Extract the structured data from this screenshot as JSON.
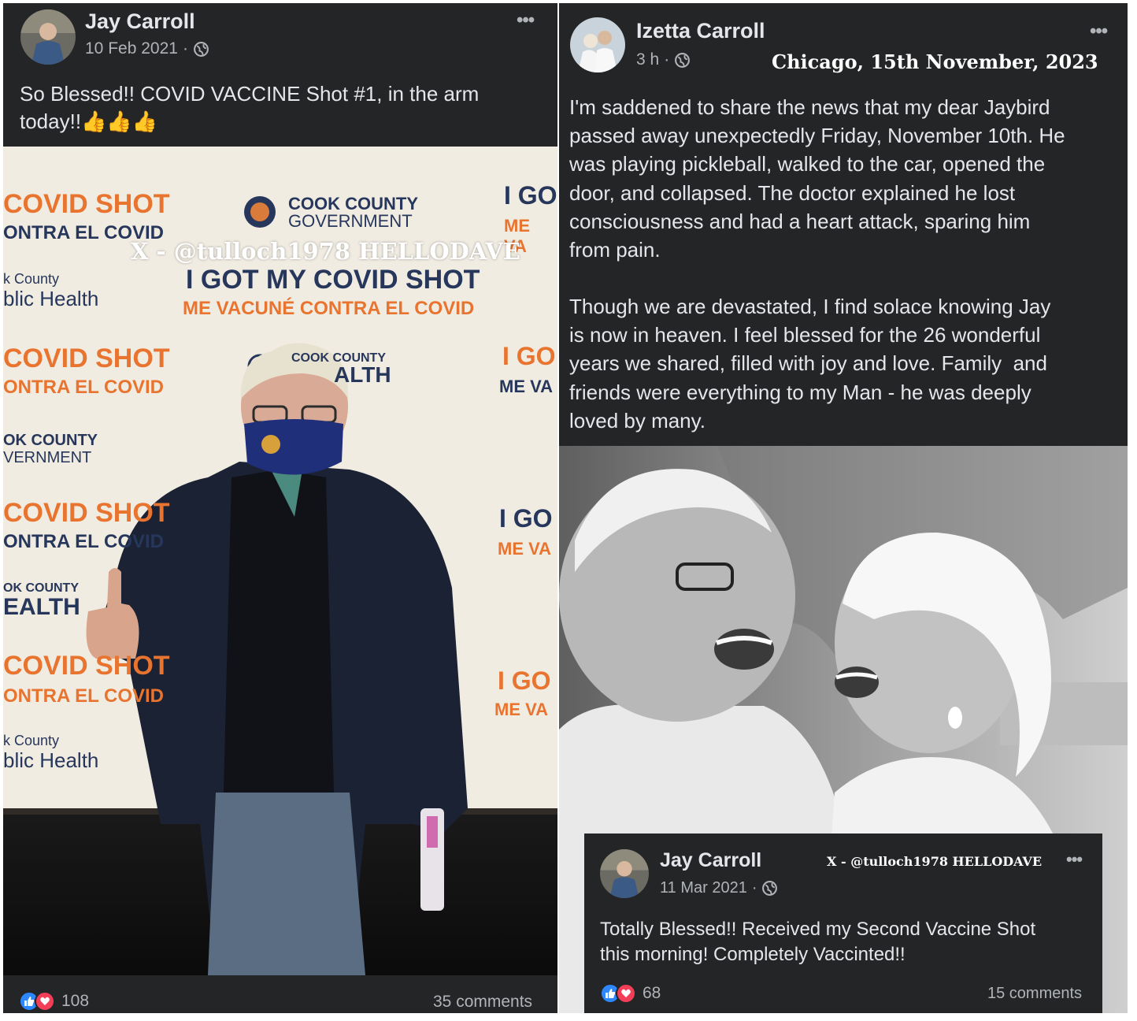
{
  "left_post": {
    "author": "Jay Carroll",
    "date": "10 Feb 2021",
    "visibility_icon": "globe-icon",
    "more_icon": "•••",
    "text": "So Blessed!! COVID VACCINE Shot #1, in the arm\ntoday!!👍👍👍",
    "image_overlay_watermark": "X - @tulloch1978 HELLODAVE",
    "backdrop_text": {
      "covid_shot": "COVID SHOT",
      "contra": "ONTRA EL COVID",
      "cook_county_gov_1": "COOK COUNTY",
      "cook_county_gov_2": "GOVERNMENT",
      "i_got": "I GOT MY COVID SHOT",
      "me_vacune": "ME VACUNÉ CONTRA EL COVID",
      "public_health_1": "k County",
      "public_health_2": "blic Health",
      "cook_health_1": "COOK COUNTY",
      "cook_health_2": "ALTH",
      "ok_county": "OK COUNTY",
      "vernment": "VERNMENT",
      "i_go": "I GO",
      "me_va": "ME VA",
      "ealth": "EALTH"
    },
    "reaction_count": "108",
    "comments": "35 comments"
  },
  "right_post": {
    "author": "Izetta Carroll",
    "time": "3 h",
    "visibility_icon": "globe-icon",
    "more_icon": "•••",
    "dateline": "Chicago, 15th November, 2023",
    "paragraph_1": "I'm saddened to share the news that my dear Jaybird\npassed away unexpectedly Friday, November 10th. He\nwas playing pickleball, walked to the car, opened the\ndoor, and collapsed. The doctor explained he lost\nconsciousness and had a heart attack, sparing him\nfrom pain.",
    "paragraph_2": "Though we are devastated, I find solace knowing Jay\nis now in heaven. I feel blessed for the 26 wonderful\nyears we shared, filled with joy and love. Family  and\nfriends were everything to my Man - he was deeply\nloved by many."
  },
  "inset_post": {
    "author": "Jay Carroll",
    "watermark": "X - @tulloch1978 HELLODAVE",
    "date": "11 Mar 2021",
    "visibility_icon": "globe-icon",
    "more_icon": "•••",
    "text": "Totally Blessed!! Received my Second Vaccine Shot\nthis morning! Completely Vaccinted!!",
    "reaction_count": "68",
    "comments": "15 comments"
  },
  "colors": {
    "panel_bg": "#242526",
    "text_primary": "#e4e6eb",
    "text_secondary": "#b0b3b8",
    "like_blue": "#2d88ff",
    "love_red": "#f33e58",
    "backdrop_orange": "#e8742f",
    "backdrop_navy": "#27375c"
  }
}
